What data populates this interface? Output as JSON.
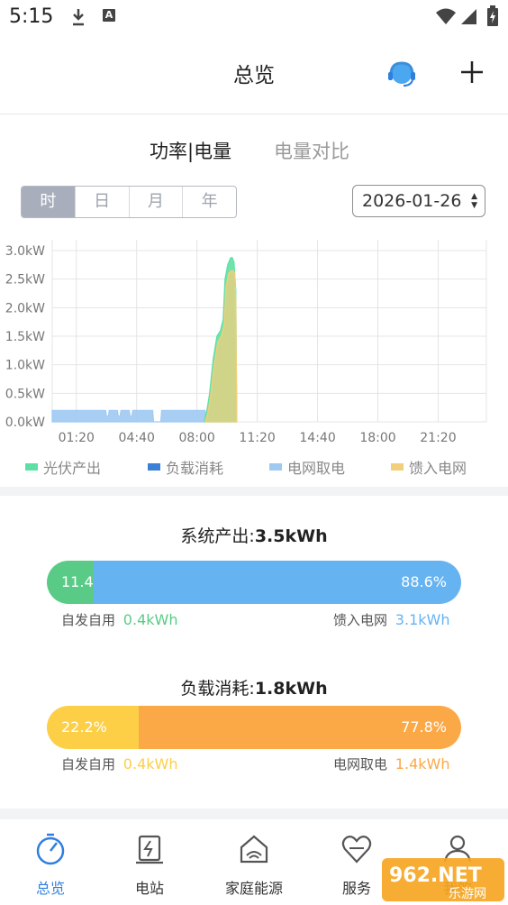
{
  "status_bar": {
    "time": "5:15"
  },
  "header": {
    "title": "总览"
  },
  "tabs": [
    {
      "label": "功率|电量",
      "active": true
    },
    {
      "label": "电量对比",
      "active": false
    }
  ],
  "period_tabs": [
    "时",
    "日",
    "月",
    "年"
  ],
  "date_picker": {
    "value": "2026-01-26"
  },
  "colors": {
    "pv": "#5ee0a5",
    "load": "#3b7fd6",
    "grid_import": "#9ec9f3",
    "feed_in": "#f1cf7c",
    "self_use_pv": "#5acb86",
    "blue_bar": "#66b3f2",
    "yellow": "#fccf47",
    "orange": "#fba847",
    "nav_active": "#2f7fe0"
  },
  "chart_data": {
    "type": "area",
    "y_ticks": [
      "0.0kW",
      "0.5kW",
      "1.0kW",
      "1.5kW",
      "2.0kW",
      "2.5kW",
      "3.0kW"
    ],
    "ylim": [
      0,
      3.0
    ],
    "x_ticks": [
      "01:20",
      "04:40",
      "08:00",
      "11:20",
      "14:40",
      "18:00",
      "21:20"
    ],
    "xlim": [
      0,
      24
    ],
    "x_tick_hours": [
      1.333,
      4.667,
      8.0,
      11.333,
      14.667,
      18.0,
      21.333
    ],
    "legend": [
      "光伏产出",
      "负载消耗",
      "电网取电",
      "馈入电网"
    ],
    "series": [
      {
        "name": "光伏产出",
        "color": "pv",
        "x": [
          8.4,
          8.55,
          8.7,
          8.9,
          9.1,
          9.3,
          9.45,
          9.55,
          9.7,
          9.85,
          9.95,
          10.05,
          10.15,
          10.2
        ],
        "y": [
          0.0,
          0.2,
          0.5,
          1.1,
          1.5,
          1.6,
          1.8,
          2.5,
          2.75,
          2.87,
          2.88,
          2.8,
          2.3,
          0.0
        ]
      },
      {
        "name": "馈入电网",
        "color": "feed_in",
        "x": [
          8.45,
          8.6,
          8.75,
          8.95,
          9.15,
          9.35,
          9.5,
          9.6,
          9.75,
          9.9,
          10.0,
          10.1,
          10.15,
          10.2
        ],
        "y": [
          0.0,
          0.15,
          0.45,
          1.0,
          1.4,
          1.5,
          1.7,
          2.35,
          2.6,
          2.65,
          2.65,
          2.6,
          2.1,
          0.0
        ]
      },
      {
        "name": "电网取电",
        "color": "grid_import",
        "x": [
          0,
          2.95,
          3.0,
          3.1,
          3.15,
          3.6,
          3.65,
          3.75,
          3.8,
          4.25,
          4.3,
          4.4,
          4.45,
          5.55,
          5.6,
          6.0,
          6.05,
          8.45,
          8.5,
          10.15,
          10.2
        ],
        "y": [
          0.2,
          0.2,
          0.1,
          0.1,
          0.2,
          0.2,
          0.1,
          0.1,
          0.2,
          0.2,
          0.1,
          0.1,
          0.2,
          0.2,
          0.0,
          0.0,
          0.2,
          0.2,
          0.0,
          0.0,
          0.0
        ]
      }
    ]
  },
  "system_output": {
    "title": "系统产出:",
    "total": "3.5kWh",
    "self_use_pct": "11.4%",
    "self_use_fraction": 0.114,
    "feed_in_pct": "88.6%",
    "self_use_label": "自发自用",
    "self_use_value": "0.4kWh",
    "feed_in_label": "馈入电网",
    "feed_in_value": "3.1kWh"
  },
  "load_consumption": {
    "title": "负载消耗:",
    "total": "1.8kWh",
    "self_use_pct": "22.2%",
    "self_use_fraction": 0.222,
    "grid_pct": "77.8%",
    "self_use_label": "自发自用",
    "self_use_value": "0.4kWh",
    "grid_label": "电网取电",
    "grid_value": "1.4kWh"
  },
  "bottom_nav": [
    {
      "label": "总览",
      "icon": "overview-icon",
      "active": true
    },
    {
      "label": "电站",
      "icon": "station-icon",
      "active": false
    },
    {
      "label": "家庭能源",
      "icon": "home-energy-icon",
      "active": false
    },
    {
      "label": "服务",
      "icon": "service-icon",
      "active": false
    },
    {
      "label": "我的",
      "icon": "profile-icon",
      "active": false
    }
  ],
  "watermark": {
    "text": "962.NET",
    "subtext": "乐游网"
  }
}
